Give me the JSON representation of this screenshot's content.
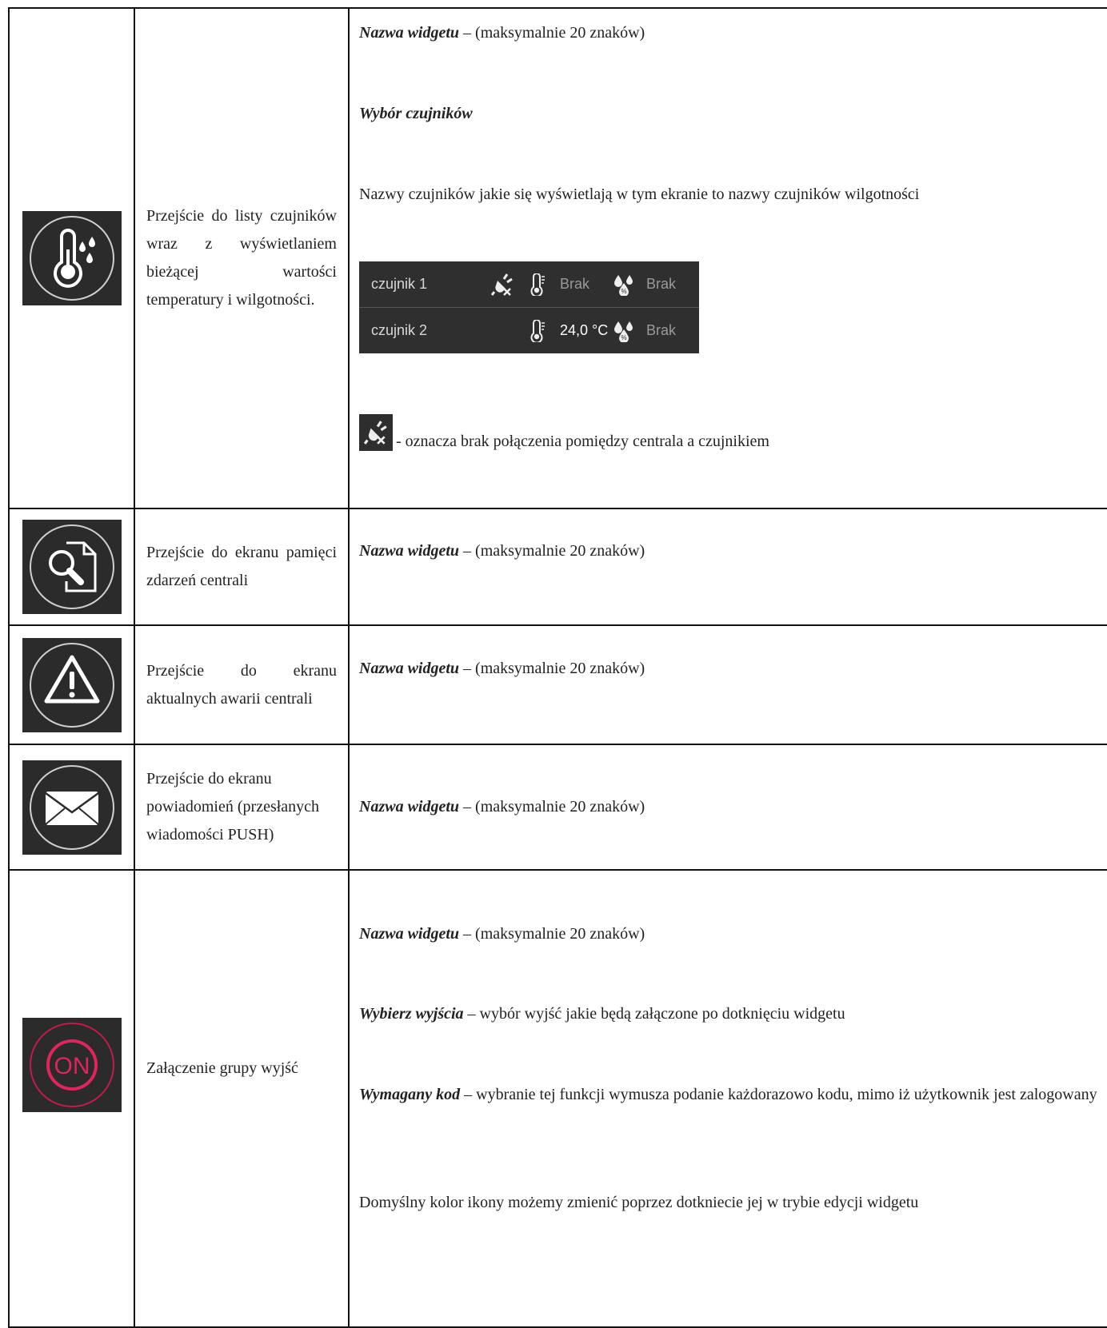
{
  "rows": [
    {
      "icon": "thermometer-humidity-icon",
      "description": "Przejście do listy czujników wraz z wyświetlaniem bieżącej wartości temperatury i wilgotności.",
      "settings": {
        "name_label": "Nazwa widgetu",
        "name_suffix": " – (maksymalnie 20 znaków)",
        "sensor_select_label": "Wybór czujników",
        "sensor_names_note": "Nazwy czujników jakie się wyświetlają w tym ekranie to nazwy czujników wilgotności",
        "sensors": [
          {
            "name": "czujnik 1",
            "disconnected": true,
            "temperature": "Brak",
            "humidity": "Brak"
          },
          {
            "name": "czujnik 2",
            "disconnected": false,
            "temperature": "24,0 °C",
            "humidity": "Brak"
          }
        ],
        "legend_icon": "plug-disconnected-icon",
        "legend_text": " - oznacza brak połączenia pomiędzy centrala a czujnikiem"
      }
    },
    {
      "icon": "event-log-search-icon",
      "description": "Przejście do ekranu pamięci zdarzeń centrali",
      "settings": {
        "name_label": "Nazwa widgetu",
        "name_suffix": " – (maksymalnie 20 znaków)"
      }
    },
    {
      "icon": "warning-triangle-icon",
      "description": "Przejście do ekranu aktualnych awarii centrali",
      "settings": {
        "name_label": "Nazwa widgetu",
        "name_suffix": " – (maksymalnie 20 znaków)"
      }
    },
    {
      "icon": "envelope-icon",
      "description": "Przejście do ekranu powiadomień (przesłanych wiadomości PUSH)",
      "settings": {
        "name_label": "Nazwa widgetu",
        "name_suffix": " – (maksymalnie 20 znaków)"
      }
    },
    {
      "icon": "on-button-icon",
      "icon_text": "ON",
      "description": "Załączenie grupy wyjść",
      "settings": {
        "name_label": "Nazwa widgetu",
        "name_suffix": " – (maksymalnie 20 znaków)",
        "outputs_label": "Wybierz wyjścia",
        "outputs_suffix": " – wybór wyjść jakie będą załączone po dotknięciu widgetu",
        "code_label": "Wymagany kod",
        "code_suffix": " – wybranie tej funkcji wymusza podanie każdorazowo kodu, mimo iż użytkownik jest zalogowany",
        "color_note": "Domyślny kolor ikony możemy zmienić poprzez dotkniecie jej w trybie edycji widgetu"
      }
    }
  ],
  "colors": {
    "icon_bg": "#2b2b2b",
    "icon_fg": "#ffffff",
    "accent_on": "#e0245e"
  }
}
